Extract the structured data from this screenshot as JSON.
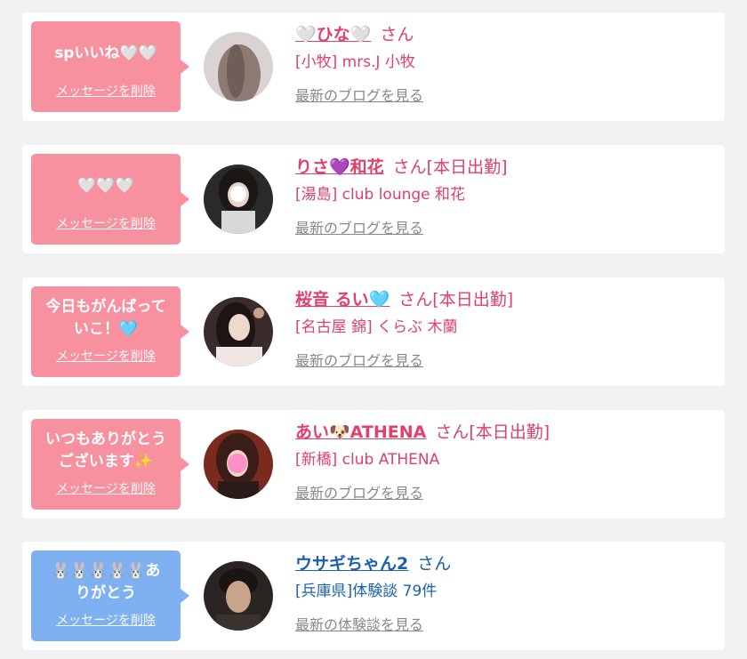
{
  "colors": {
    "pink": "#f7909f",
    "blue_bubble": "#7fb0f2",
    "name_pink": "#e0406a",
    "name_blue": "#1c5fb0"
  },
  "items": [
    {
      "message": "spいいね🤍🤍",
      "delete_label": "メッセージを削除",
      "name": "🤍ひな🤍",
      "suffix": "さん",
      "store": "[小牧] mrs.J 小牧",
      "link": "最新のブログを見る",
      "avatar_icon": "avatar-hair-photo"
    },
    {
      "message": "🤍🤍🤍",
      "delete_label": "メッセージを削除",
      "name": "りさ💜和花",
      "suffix": "さん[本日出勤]",
      "store": "[湯島] club lounge 和花",
      "link": "最新のブログを見る",
      "avatar_icon": "avatar-woman-photo"
    },
    {
      "message": "今日もがんばって\nいこ！🩵",
      "delete_label": "メッセージを削除",
      "name": "桜音 るい🩵",
      "suffix": "さん[本日出勤]",
      "store": "[名古屋 錦] くらぶ 木蘭",
      "link": "最新のブログを見る",
      "avatar_icon": "avatar-woman-photo"
    },
    {
      "message": "いつもありがとう\nございます✨",
      "delete_label": "メッセージを削除",
      "name": "あい🐶ATHENA",
      "suffix": "さん[本日出勤]",
      "store": "[新橋] club ATHENA",
      "link": "最新のブログを見る",
      "avatar_icon": "avatar-woman-photo"
    },
    {
      "message": "🐰🐰🐰🐰🐰あ\nりがとう",
      "delete_label": "メッセージを削除",
      "name": "ウサギちゃん2",
      "suffix": "さん",
      "store": "[兵庫県]体験談 79件",
      "link": "最新の体験談を見る",
      "avatar_icon": "avatar-man-photo"
    }
  ]
}
